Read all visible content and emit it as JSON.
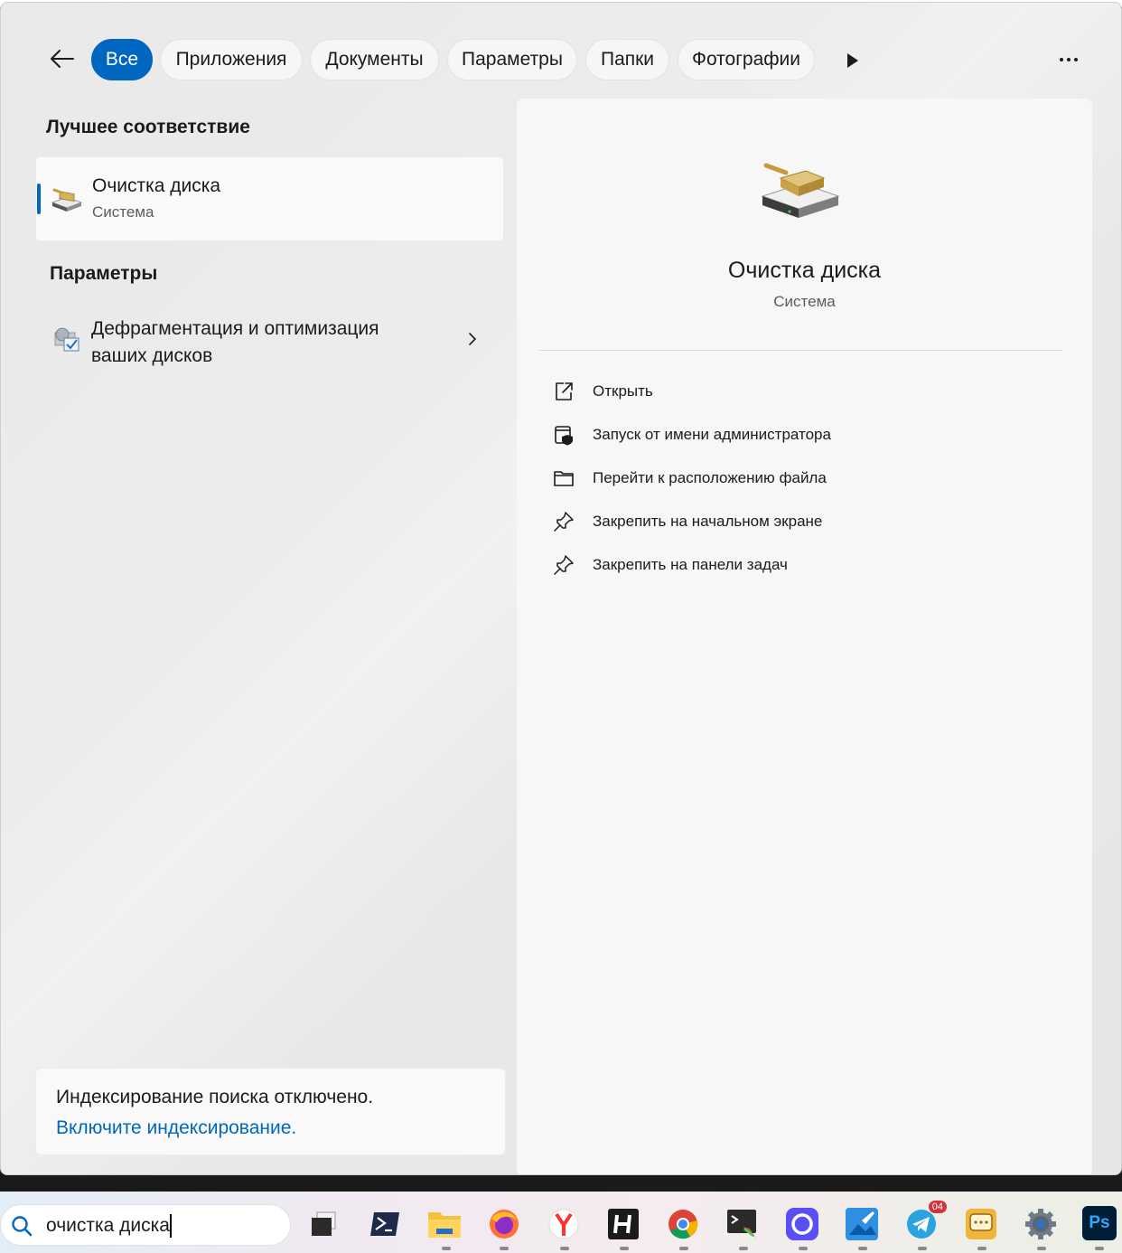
{
  "filters": {
    "back_label": "",
    "chips": [
      "Все",
      "Приложения",
      "Документы",
      "Параметры",
      "Папки",
      "Фотографии"
    ],
    "active_chip": "Все"
  },
  "results": {
    "best_match_title": "Лучшее соответствие",
    "best_match": {
      "name": "Очистка диска",
      "type": "Система",
      "icon": "disk-cleanup-icon"
    },
    "settings_title": "Параметры",
    "settings_item": {
      "name": "Дефрагментация и оптимизация ваших дисков",
      "icon": "defrag-icon"
    }
  },
  "indexing": {
    "message": "Индексирование поиска отключено.",
    "link": "Включите индексирование."
  },
  "detail": {
    "name": "Очистка диска",
    "type": "Система",
    "actions": [
      {
        "label": "Открыть",
        "icon": "open-external-icon"
      },
      {
        "label": "Запуск от имени администратора",
        "icon": "run-as-admin-icon"
      },
      {
        "label": "Перейти к расположению файла",
        "icon": "folder-icon"
      },
      {
        "label": "Закрепить на начальном экране",
        "icon": "pin-icon"
      },
      {
        "label": "Закрепить на панели задач",
        "icon": "pin-icon"
      }
    ]
  },
  "taskbar": {
    "search_value": "очистка диска",
    "apps": [
      {
        "name": "task-view-icon"
      },
      {
        "name": "powershell-icon"
      },
      {
        "name": "file-explorer-icon"
      },
      {
        "name": "firefox-icon"
      },
      {
        "name": "yandex-browser-icon"
      },
      {
        "name": "h-app-icon"
      },
      {
        "name": "chrome-icon"
      },
      {
        "name": "terminal-icon"
      },
      {
        "name": "messenger-icon"
      },
      {
        "name": "paint-icon"
      },
      {
        "name": "telegram-icon",
        "badge": "04"
      },
      {
        "name": "chat-icon"
      },
      {
        "name": "settings-icon"
      },
      {
        "name": "photoshop-icon",
        "label": "Ps"
      }
    ]
  },
  "colors": {
    "accent": "#0067c0",
    "link": "#0067c0"
  }
}
